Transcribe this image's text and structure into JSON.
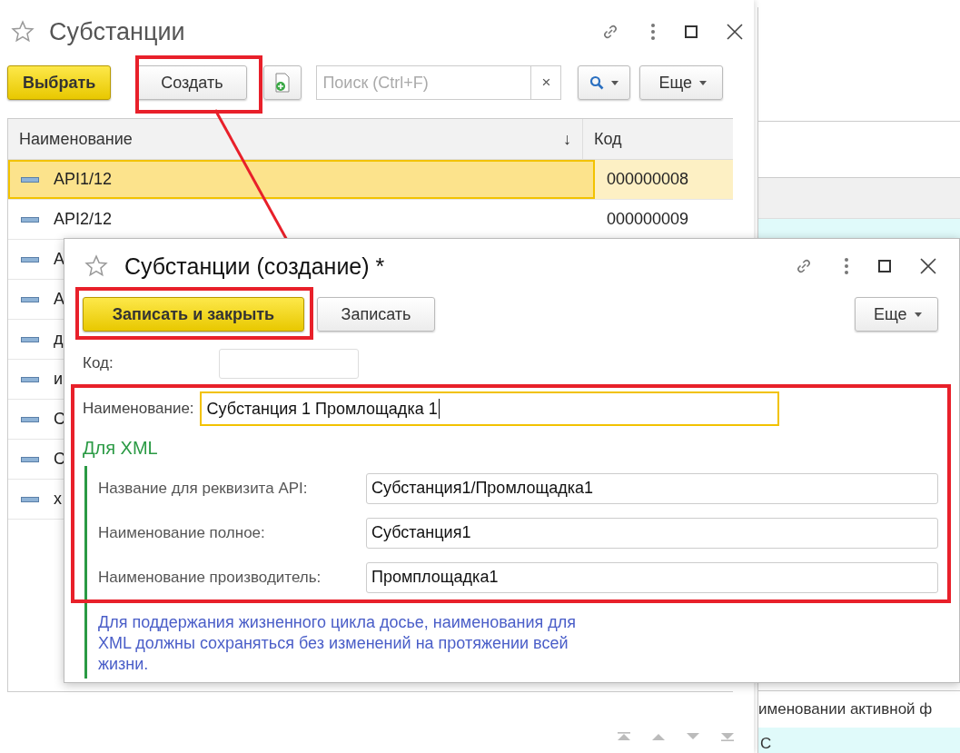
{
  "background_panel": {
    "row_texts": [
      "именовании активной ф",
      "С"
    ]
  },
  "list_window": {
    "title": "Субстанции",
    "toolbar": {
      "buttons": [
        {
          "label": "Выбрать",
          "kind": "primary"
        },
        {
          "label": "Создать",
          "kind": "default"
        }
      ],
      "search": {
        "placeholder": "Поиск (Ctrl+F)",
        "clear": "×"
      },
      "more": "Еще"
    },
    "table": {
      "columns": [
        "Наименование",
        "Код"
      ],
      "sort_mark": "↓",
      "rows": [
        {
          "name": "API1/12",
          "code": "000000008",
          "selected": true
        },
        {
          "name": "API2/12",
          "code": "000000009",
          "selected": false
        },
        {
          "name": "А",
          "selected": false
        },
        {
          "name": "А",
          "selected": false
        },
        {
          "name": "д",
          "selected": false
        },
        {
          "name": "и",
          "selected": false
        },
        {
          "name": "С",
          "selected": false
        },
        {
          "name": "С",
          "selected": false
        },
        {
          "name": "х",
          "selected": false
        }
      ]
    }
  },
  "dialog": {
    "title": "Субстанции (создание) *",
    "buttons": [
      {
        "label": "Записать и закрыть",
        "kind": "primary"
      },
      {
        "label": "Записать",
        "kind": "default"
      }
    ],
    "more": "Еще",
    "code_field": {
      "label": "Код:"
    },
    "name_field": {
      "label": "Наименование:",
      "value": "Субстанция 1 Промлощадка 1"
    },
    "group": {
      "title": "Для XML",
      "fields": [
        {
          "label": "Название для реквизита API:",
          "value": "Субстанция1/Промлощадка1"
        },
        {
          "label": "Наименование полное:",
          "value": "Субстанция1"
        },
        {
          "label": "Наименование производитель:",
          "value": "Промплощадка1"
        }
      ],
      "note": "Для поддержания жизненного цикла досье, наименования для XML должны сохраняться без изменений на протяжении всей жизни."
    }
  }
}
